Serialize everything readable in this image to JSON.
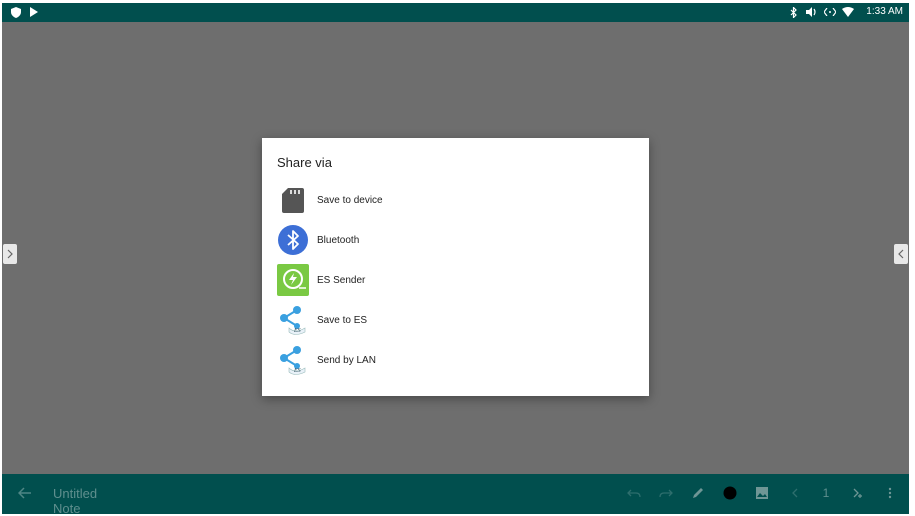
{
  "status_bar": {
    "left_icons": [
      "shield-icon",
      "play-store-icon"
    ],
    "right_icons": [
      "bluetooth-icon",
      "volume-icon",
      "ethernet-icon",
      "wifi-icon"
    ],
    "time": "1:33 AM"
  },
  "dialog": {
    "title": "Share via",
    "items": [
      {
        "label": "Save to device",
        "icon": "sd-card-icon"
      },
      {
        "label": "Bluetooth",
        "icon": "bluetooth-icon"
      },
      {
        "label": "ES Sender",
        "icon": "es-sender-icon"
      },
      {
        "label": "Save to ES",
        "icon": "es-share-icon"
      },
      {
        "label": "Send by LAN",
        "icon": "es-share-icon"
      }
    ]
  },
  "bottom_bar": {
    "title": "Untitled Note",
    "page_number": "1"
  },
  "colors": {
    "bar_background": "#014f4e",
    "scrim": "#6e6e6e",
    "bluetooth_blue": "#3d6fd6",
    "es_green": "#7ac943",
    "share_blue": "#3aa0e0"
  }
}
